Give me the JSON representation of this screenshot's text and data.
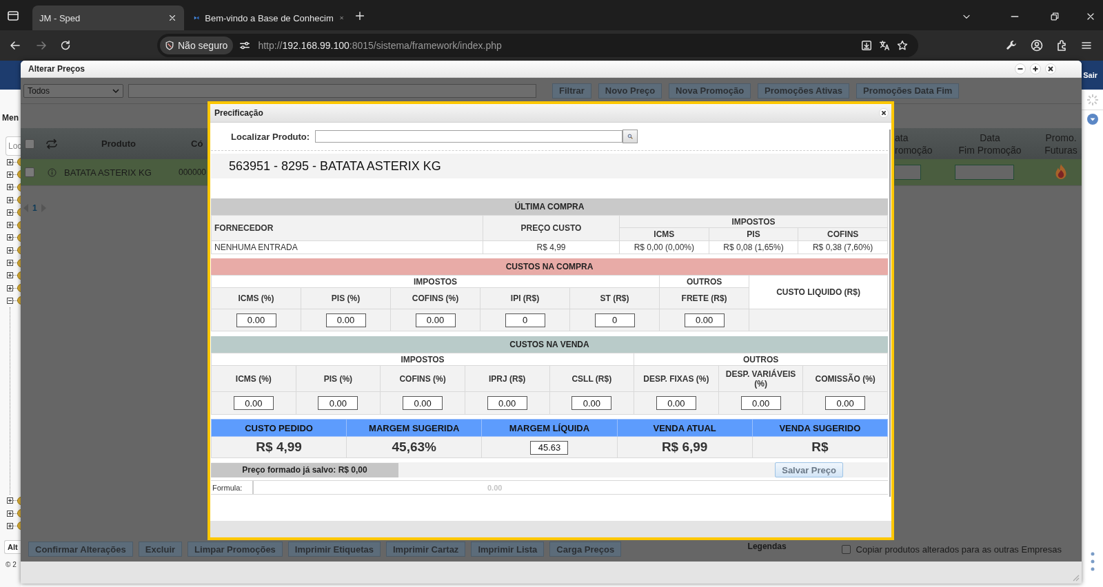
{
  "browser": {
    "tabs": [
      {
        "title": "JM - Sped",
        "selected": true
      },
      {
        "title": "Bem-vindo a Base de Conhecim",
        "selected": false
      }
    ],
    "security_label": "Não seguro",
    "url": {
      "scheme": "http://",
      "host": "192.168.99.100",
      "rest": ":8015/sistema/framework/index.php"
    }
  },
  "page": {
    "logout": "Sair",
    "menu_title": "Men",
    "search_placeholder": "Loc",
    "tree": [
      {
        "expanded": false
      },
      {
        "expanded": false
      },
      {
        "expanded": false
      },
      {
        "expanded": false
      },
      {
        "expanded": false
      },
      {
        "expanded": false
      },
      {
        "expanded": false
      },
      {
        "expanded": false
      },
      {
        "expanded": false
      },
      {
        "expanded": false
      },
      {
        "expanded": false
      },
      {
        "expanded": true
      },
      {
        "expanded": false
      },
      {
        "expanded": false
      },
      {
        "expanded": false
      }
    ],
    "bottom_tab": "Alt",
    "footer": "© 2"
  },
  "window": {
    "title": "Alterar Preços",
    "filter": "Todos",
    "toolbar_buttons": [
      "Filtrar",
      "Novo Preço",
      "Nova Promoção",
      "Promoções Ativas",
      "Promoções Data Fim"
    ],
    "table": {
      "select_all": false,
      "columns_left": [
        "Produto",
        "Có"
      ],
      "columns_right": [
        "ata\nromoção",
        "Data\nFim Promoção",
        "Promo.\nFuturas"
      ],
      "rows": [
        {
          "selected": true,
          "checked": false,
          "product": "BATATA ASTERIX KG",
          "code": "000000"
        }
      ]
    },
    "pagination": {
      "page": "1"
    },
    "action_buttons": [
      "Confirmar Alterações",
      "Excluir",
      "Limpar Promoções",
      "Imprimir Etiquetas",
      "Imprimir Cartaz",
      "Imprimir Lista",
      "Carga Preços"
    ],
    "legend": "Legendas",
    "copy_option": {
      "label": "Copiar produtos alterados para as outras Empresas",
      "checked": false
    }
  },
  "modal": {
    "title": "Precificação",
    "search_label": "Localizar Produto:",
    "product": "563951 - 8295 - BATATA ASTERIX KG",
    "last_purchase": {
      "title": "ÚLTIMA COMPRA",
      "supplier_header": "FORNECEDOR",
      "cost_header": "PREÇO CUSTO",
      "taxes_header": "IMPOSTOS",
      "tax_columns": [
        "ICMS",
        "PIS",
        "COFINS"
      ],
      "row": {
        "supplier": "NENHUMA ENTRADA",
        "cost": "R$ 4,99",
        "taxes": [
          "R$ 0,00 (0,00%)",
          "R$ 0,08 (1,65%)",
          "R$ 0,38 (7,60%)"
        ]
      }
    },
    "purchase_costs": {
      "title": "CUSTOS NA COMPRA",
      "taxes": {
        "header": "IMPOSTOS",
        "fields": [
          {
            "label": "ICMS (%)",
            "value": "0.00"
          },
          {
            "label": "PIS (%)",
            "value": "0.00"
          },
          {
            "label": "COFINS (%)",
            "value": "0.00"
          },
          {
            "label": "IPI (R$)",
            "value": "0"
          },
          {
            "label": "ST (R$)",
            "value": "0"
          }
        ]
      },
      "others": {
        "header": "OUTROS",
        "fields": [
          {
            "label": "FRETE (R$)",
            "value": "0.00"
          }
        ]
      },
      "net_cost_header": "CUSTO LIQUIDO (R$)"
    },
    "sale_costs": {
      "title": "CUSTOS NA VENDA",
      "taxes": {
        "header": "IMPOSTOS",
        "fields": [
          {
            "label": "ICMS (%)",
            "value": "0.00"
          },
          {
            "label": "PIS (%)",
            "value": "0.00"
          },
          {
            "label": "COFINS (%)",
            "value": "0.00"
          },
          {
            "label": "IPRJ (R$)",
            "value": "0.00"
          },
          {
            "label": "CSLL (R$)",
            "value": "0.00"
          }
        ]
      },
      "others": {
        "header": "OUTROS",
        "fields": [
          {
            "label": "DESP. FIXAS (%)",
            "value": "0.00"
          },
          {
            "label": "DESP. VARIÁVEIS (%)",
            "value": "0.00"
          },
          {
            "label": "COMISSÃO (%)",
            "value": "0.00"
          }
        ]
      }
    },
    "summary": [
      {
        "label": "CUSTO PEDIDO",
        "value": "R$ 4,99",
        "kind": "text"
      },
      {
        "label": "MARGEM SUGERIDA",
        "value": "45,63%",
        "kind": "text"
      },
      {
        "label": "MARGEM LÍQUIDA",
        "value": "45.63",
        "kind": "input"
      },
      {
        "label": "VENDA ATUAL",
        "value": "R$ 6,99",
        "kind": "text"
      },
      {
        "label": "VENDA SUGERIDO",
        "value": "R$",
        "kind": "text"
      }
    ],
    "saved_price": "Preço formado já salvo: R$ 0,00",
    "save_button": "Salvar Preço",
    "formula_label": "Formula:",
    "formula_value": "0.00"
  }
}
